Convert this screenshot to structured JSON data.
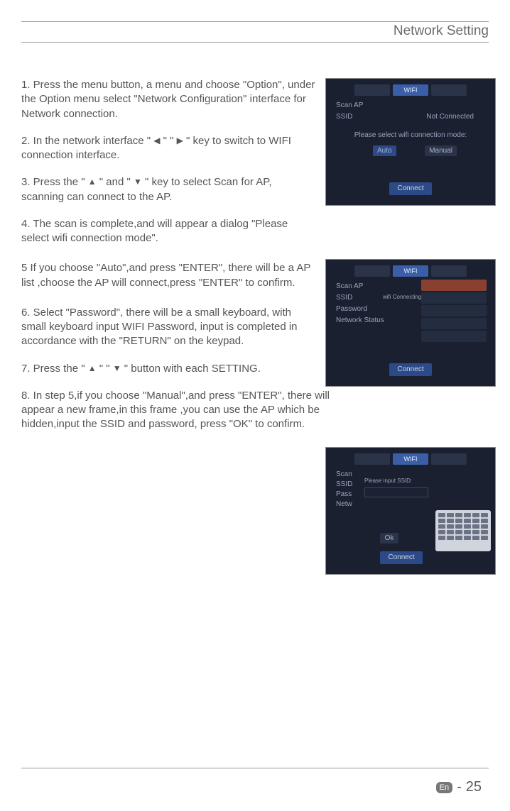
{
  "header": {
    "title": "Network Setting"
  },
  "steps": {
    "s1": "1. Press the menu button, a menu and choose \"Option\", under the Option menu select \"Network Configuration\" interface for Network connection.",
    "s2a": "2. In the network interface \" ",
    "s2b": " \" \" ",
    "s2c": " \" key to switch to WIFI connection interface.",
    "s3a": "3. Press the \" ",
    "s3b": " \" and \" ",
    "s3c": " \" key to select Scan for AP, scanning can connect to the AP.",
    "s4": "4. The scan is complete,and will appear a dialog \"Please select wifi connection mode\".",
    "s5": "5 If you choose \"Auto\",and press \"ENTER\", there will be a AP list ,choose the AP will connect,press \"ENTER\" to confirm.",
    "s6": "6. Select \"Password\", there will be a small keyboard, with small keyboard input WIFI Password, input is completed in accordance with the \"RETURN\" on the keypad.",
    "s7a": "7. Press the \" ",
    "s7b": " \" \" ",
    "s7c": " \" button with each SETTING.",
    "s8": "8.  In step 5,if you choose \"Manual\",and press \"ENTER\", there will appear a new frame,in this frame ,you can use the AP which be hidden,input the SSID and password, press \"OK\" to confirm."
  },
  "arrows": {
    "left": "◀",
    "right": "▶",
    "up": "▲",
    "down": "▼"
  },
  "screens": {
    "s1": {
      "wifi": "WIFI",
      "scan": "Scan AP",
      "ssid": "SSID",
      "notconn": "Not Connected",
      "prompt": "Please select wifi connection mode:",
      "auto": "Auto",
      "manual": "Manual",
      "connect": "Connect"
    },
    "s2": {
      "wifi": "WIFI",
      "scan": "Scan AP",
      "ssid": "SSID",
      "password": "Password",
      "netstatus": "Network Status",
      "conn": "wifi Connecting",
      "connect": "Connect"
    },
    "s3": {
      "wifi": "WIFI",
      "scan": "Scan",
      "ssid": "SSID",
      "pass": "Pass",
      "netw": "Netw",
      "prompt": "Please input SSID:",
      "ok": "Ok",
      "connect": "Connect"
    }
  },
  "footer": {
    "en": "En",
    "sep": "-",
    "page": "25"
  }
}
